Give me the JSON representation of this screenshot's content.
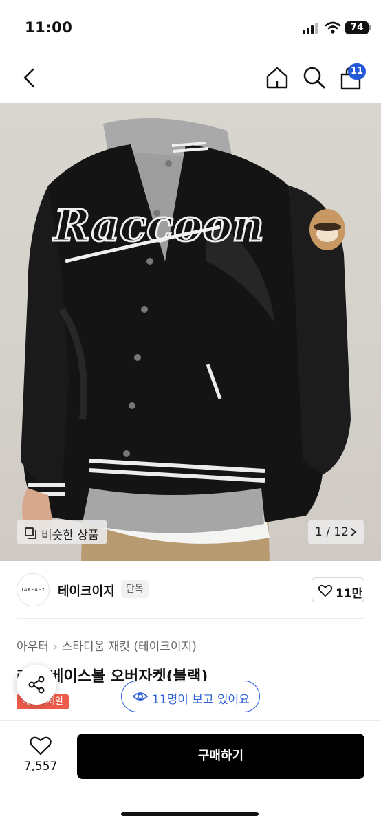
{
  "status_bar": {
    "time": "11:00",
    "battery": "74"
  },
  "nav": {
    "cart_count": "11"
  },
  "image": {
    "jacket_text": "Raccoon",
    "similar_label": "비슷한 상품",
    "counter": "1 / 12"
  },
  "shop": {
    "logo_text": "TAKEASY",
    "name": "테이크이지",
    "tag": "단독",
    "likes": "11만"
  },
  "product": {
    "breadcrumb": [
      "아우터",
      "스타디움 재킷 (테이크이지)"
    ],
    "title": "라쿤 베이스볼 오버자켓(블랙)",
    "badge": "애프터세일"
  },
  "viewers": {
    "label": "11명이 보고 있어요"
  },
  "bottom": {
    "wish_count": "7,557",
    "buy_label": "구매하기"
  },
  "colors": {
    "accent_blue": "#2e62d9",
    "badge_blue": "#2459d8",
    "sale_red": "#ee5b4a",
    "buy_black": "#000000"
  }
}
